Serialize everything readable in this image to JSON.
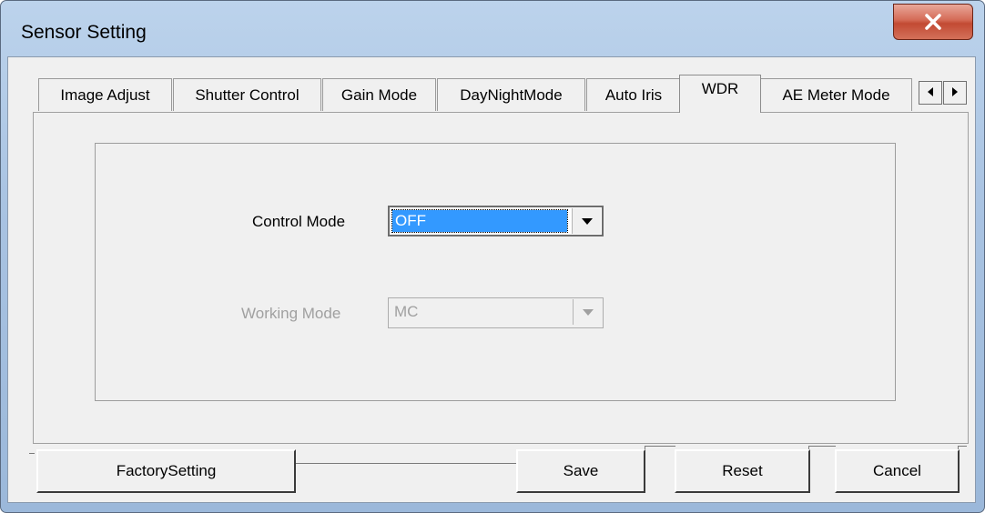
{
  "window": {
    "title": "Sensor Setting"
  },
  "tabs": [
    {
      "label": "Image Adjust"
    },
    {
      "label": "Shutter Control"
    },
    {
      "label": "Gain Mode"
    },
    {
      "label": "DayNightMode"
    },
    {
      "label": "Auto Iris"
    },
    {
      "label": "WDR",
      "active": true
    },
    {
      "label": "AE Meter Mode"
    }
  ],
  "form": {
    "control_mode": {
      "label": "Control Mode",
      "value": "OFF",
      "enabled": true
    },
    "working_mode": {
      "label": "Working Mode",
      "value": "MC",
      "enabled": false
    }
  },
  "buttons": {
    "factory": "FactorySetting",
    "save": "Save",
    "reset": "Reset",
    "cancel": "Cancel"
  },
  "icons": {
    "close": "close-icon",
    "scroll_left": "chevron-left-icon",
    "scroll_right": "chevron-right-icon",
    "dropdown": "chevron-down-icon"
  },
  "colors": {
    "selection": "#3399ff",
    "close_button": "#c24a33",
    "dialog_bg": "#f0f0f0"
  }
}
